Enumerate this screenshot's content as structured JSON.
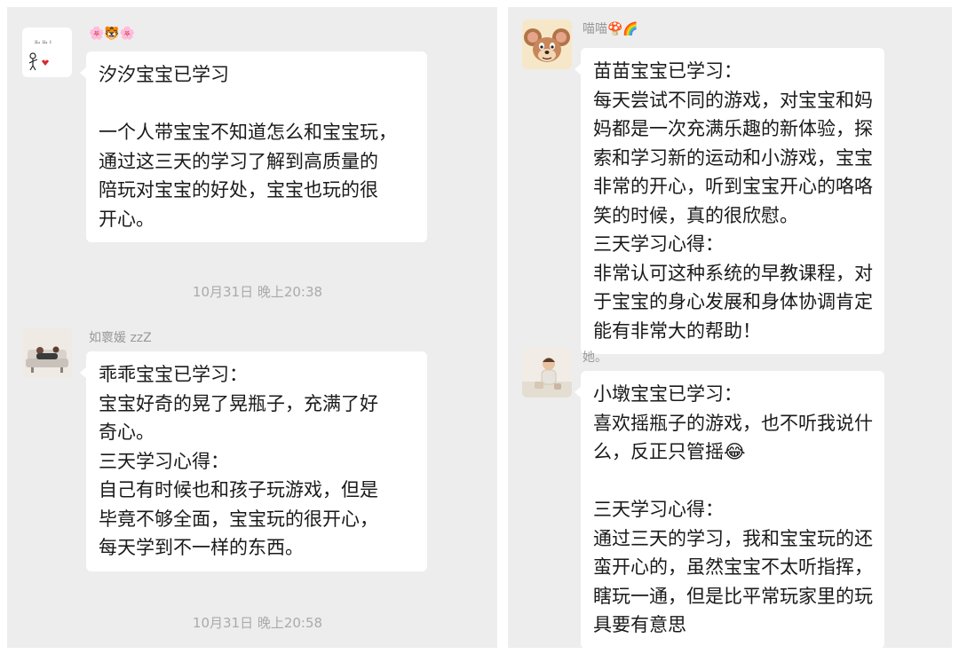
{
  "left_panel": {
    "messages": [
      {
        "sender": "🌸🐯🌸",
        "avatar": "stick-figure-heart-icon",
        "lines": [
          "汐汐宝宝已学习",
          "",
          "一个人带宝宝不知道怎么和宝宝玩，",
          "通过这三天的学习了解到高质量的",
          "陪玩对宝宝的好处，宝宝也玩的很",
          "开心。"
        ]
      },
      {
        "sender": "如褱媛 zzZ",
        "avatar": "sofa-photo-icon",
        "lines": [
          "乖乖宝宝已学习：",
          "宝宝好奇的晃了晃瓶子，充满了好",
          "奇心。",
          "三天学习心得：",
          "自己有时候也和孩子玩游戏，但是",
          "毕竟不够全面，宝宝玩的很开心，",
          "每天学到不一样的东西。"
        ]
      }
    ],
    "timestamps": [
      "10月31日 晚上20:38",
      "10月31日 晚上20:58"
    ]
  },
  "right_panel": {
    "messages": [
      {
        "sender": "喵喵🍄🌈",
        "avatar": "cartoon-mouse-icon",
        "lines": [
          "苗苗宝宝已学习：",
          "每天尝试不同的游戏，对宝宝和妈",
          "妈都是一次充满乐趣的新体验，探",
          "索和学习新的运动和小游戏，宝宝",
          "非常的开心，听到宝宝开心的咯咯",
          "笑的时候，真的很欣慰。",
          "三天学习心得：",
          "非常认可这种系统的早教课程，对",
          "于宝宝的身心发展和身体协调肯定",
          "能有非常大的帮助！"
        ]
      },
      {
        "sender": "她。",
        "avatar": "baby-photo-icon",
        "lines": [
          "小墩宝宝已学习：",
          "喜欢摇瓶子的游戏，也不听我说什",
          "么，反正只管摇😂",
          "",
          "三天学习心得：",
          "通过三天的学习，我和宝宝玩的还",
          "蛮开心的，虽然宝宝不太听指挥，",
          "瞎玩一通，但是比平常玩家里的玩",
          "具要有意思"
        ]
      }
    ]
  }
}
